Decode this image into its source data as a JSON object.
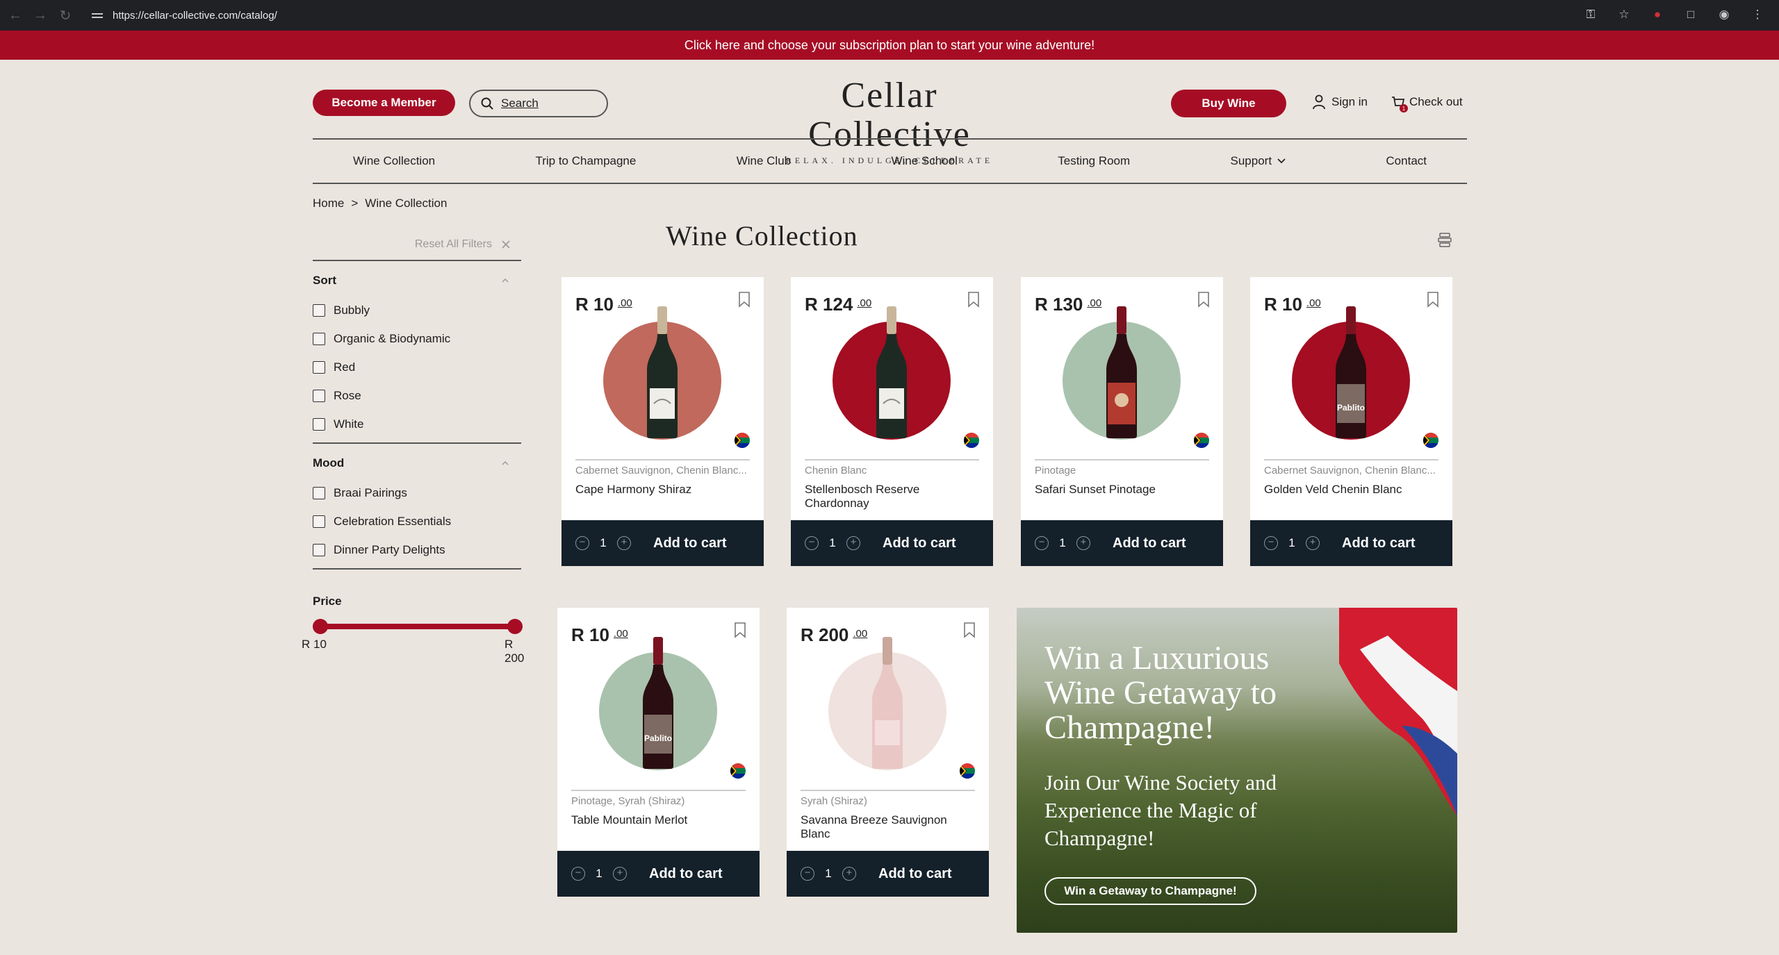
{
  "browser": {
    "url": "https://cellar-collective.com/catalog/"
  },
  "promo_bar": {
    "text": "Click here and choose your subscription plan to start your wine adventure!"
  },
  "header": {
    "member_button": "Become a Member",
    "search_label": "Search",
    "logo_title": "Cellar Collective",
    "logo_tagline": "RELAX. INDULGE. CELEBRATE",
    "buy_button": "Buy Wine",
    "sign_in": "Sign in",
    "checkout": "Check out",
    "cart_count": "1"
  },
  "nav": {
    "items": [
      "Wine Collection",
      "Trip to Champagne",
      "Wine Club",
      "Wine School",
      "Testing Room",
      "Support",
      "Contact"
    ]
  },
  "breadcrumb": {
    "home": "Home",
    "separator": ">",
    "current": "Wine Collection"
  },
  "filters": {
    "reset_label": "Reset All Filters",
    "sort": {
      "title": "Sort",
      "options": [
        "Bubbly",
        "Organic & Biodynamic",
        "Red",
        "Rose",
        "White"
      ]
    },
    "mood": {
      "title": "Mood",
      "options": [
        "Braai Pairings",
        "Celebration Essentials",
        "Dinner Party Delights"
      ]
    },
    "price": {
      "title": "Price",
      "min_label": "R 10",
      "max_label": "R 200",
      "range_low_fraction": 0.0,
      "range_high_fraction": 1.0
    }
  },
  "main": {
    "title": "Wine Collection"
  },
  "products": [
    {
      "price": "R 10",
      "cents": ".00",
      "grape": "Cabernet Sauvignon, Chenin Blanc...",
      "name": "Cape Harmony Shiraz",
      "qty": "1",
      "cta": "Add to cart",
      "bottle": "bubbly",
      "circle": "#c0695c"
    },
    {
      "price": "R 124",
      "cents": ".00",
      "grape": "Chenin Blanc",
      "name": "Stellenbosch Reserve Chardonnay",
      "qty": "1",
      "cta": "Add to cart",
      "bottle": "bubbly",
      "circle": "#a40d22"
    },
    {
      "price": "R 130",
      "cents": ".00",
      "grape": "Pinotage",
      "name": "Safari Sunset Pinotage",
      "qty": "1",
      "cta": "Add to cart",
      "bottle": "red-label",
      "circle": "#a9c2ad"
    },
    {
      "price": "R 10",
      "cents": ".00",
      "grape": "Cabernet Sauvignon, Chenin Blanc...",
      "name": "Golden Veld Chenin Blanc",
      "qty": "1",
      "cta": "Add to cart",
      "bottle": "pablito",
      "circle": "#a40d22"
    },
    {
      "price": "R 10",
      "cents": ".00",
      "grape": "Pinotage, Syrah (Shiraz)",
      "name": "Table Mountain Merlot",
      "qty": "1",
      "cta": "Add to cart",
      "bottle": "pablito",
      "circle": "#a9c2ad"
    },
    {
      "price": "R 200",
      "cents": ".00",
      "grape": "Syrah (Shiraz)",
      "name": "Savanna Breeze Sauvignon Blanc",
      "qty": "1",
      "cta": "Add to cart",
      "bottle": "rose",
      "circle": "#f0e2de"
    }
  ],
  "promo_card": {
    "heading": "Win a Luxurious Wine Getaway to Champagne!",
    "subheading": "Join Our Wine Society and Experience the Magic of Champagne!",
    "cta": "Win a Getaway to Champagne!"
  },
  "colors": {
    "brand_red": "#a60d25",
    "cart_bar": "#14202a",
    "page_bg": "#ebe5df"
  }
}
